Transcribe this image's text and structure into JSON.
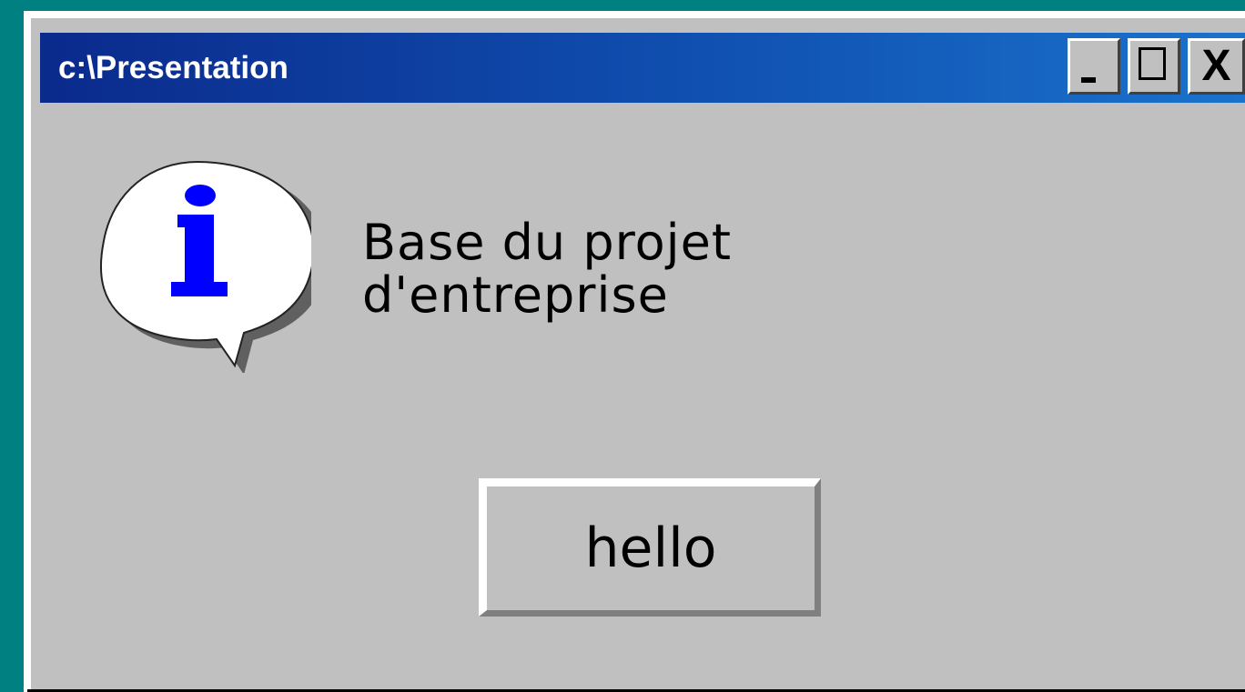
{
  "window": {
    "title": "c:\\Presentation",
    "controls": {
      "minimize": "_",
      "maximize": "□",
      "close": "X"
    }
  },
  "dialog": {
    "icon": "info-icon",
    "message_line1": "Base du  projet",
    "message_line2": "d'entreprise",
    "button_label": "hello"
  },
  "colors": {
    "desktop": "#008080",
    "window_face": "#c0c0c0",
    "titlebar_start": "#0a2a8c",
    "titlebar_end": "#1a72cc",
    "info_glyph": "#0000ff"
  }
}
